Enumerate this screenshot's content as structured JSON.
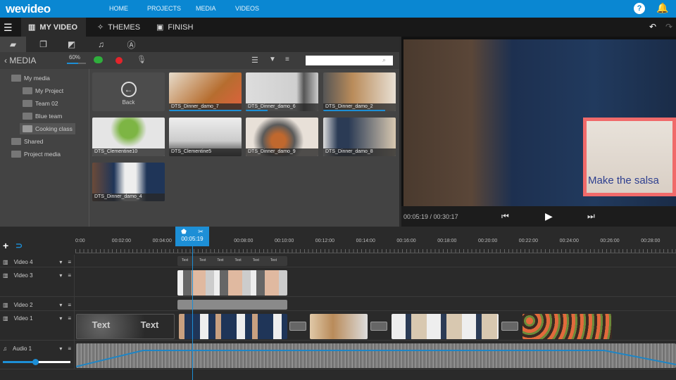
{
  "app": {
    "logo": "wevideo",
    "nav": [
      "HOME",
      "PROJECTS",
      "MEDIA",
      "VIDEOS"
    ],
    "help_icon": "help-circle-icon",
    "notif_icon": "bell-icon",
    "brand_color": "#0a87d2"
  },
  "tabs": [
    {
      "label": "MY VIDEO",
      "icon": "film-icon",
      "active": true
    },
    {
      "label": "THEMES",
      "icon": "magic-wand-icon"
    },
    {
      "label": "FINISH",
      "icon": "finish-film-icon"
    }
  ],
  "media": {
    "title": "MEDIA",
    "storage": "60%",
    "storage_fraction": 0.6,
    "search_placeholder": "",
    "folders": [
      {
        "label": "My media",
        "level": 0
      },
      {
        "label": "My Project",
        "level": 1
      },
      {
        "label": "Team 02",
        "level": 1
      },
      {
        "label": "Blue team",
        "level": 1
      },
      {
        "label": "Cooking class",
        "level": 1,
        "selected": true
      },
      {
        "label": "Shared",
        "level": 0
      },
      {
        "label": "Project media",
        "level": 0
      }
    ],
    "back_label": "Back",
    "items": [
      {
        "name": "DTS_Dinner_damo_7",
        "used": true
      },
      {
        "name": "DTS_Dinner_damo_6",
        "used": true
      },
      {
        "name": "DTS_Dinner_damo_2",
        "used": true
      },
      {
        "name": "DTS_Clementine10"
      },
      {
        "name": "DTS_Clementine5"
      },
      {
        "name": "DTS_Dinner_damo_9"
      },
      {
        "name": "DTS_Dinner_damo_8"
      },
      {
        "name": "DTS_Dinner_damo_4"
      }
    ]
  },
  "preview": {
    "time": "00:05:19 / 00:30:17",
    "overlay_text": "Make the salsa"
  },
  "timeline": {
    "playhead": "00:05:19",
    "ticks": [
      "0:00",
      "00:02:00",
      "00:04:00",
      "00:06:00",
      "00:08:00",
      "00:10:00",
      "00:12:00",
      "00:14:00",
      "00:16:00",
      "00:18:00",
      "00:20:00",
      "00:22:00",
      "00:24:00",
      "00:26:00",
      "00:28:00"
    ],
    "tracks": [
      {
        "label": "Video 4"
      },
      {
        "label": "Video 3"
      },
      {
        "label": "Video 2"
      },
      {
        "label": "Video 1"
      },
      {
        "label": "Audio 1"
      }
    ],
    "text_clip": "Text",
    "audio_volume": 0.45
  }
}
